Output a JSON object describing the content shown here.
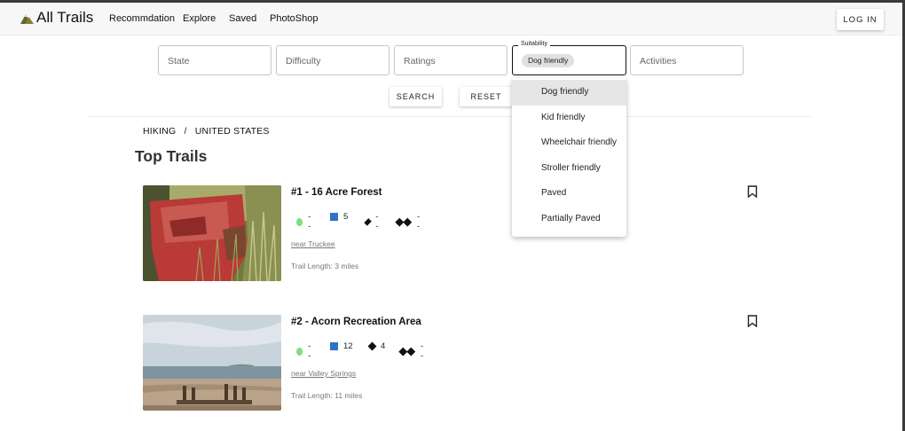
{
  "navbar": {
    "brand": "All Trails",
    "links": [
      "Recommdation",
      "Explore",
      "Saved",
      "PhotoShop"
    ],
    "login": "LOG IN"
  },
  "filters": {
    "state": "State",
    "difficulty": "Difficulty",
    "ratings": "Ratings",
    "suitability_label": "Suitability",
    "suitability_chip": "Dog friendly",
    "activities": "Activities"
  },
  "actions": {
    "search": "SEARCH",
    "reset": "RESET"
  },
  "breadcrumb": {
    "first": "HIKING",
    "sep": "/",
    "second": "UNITED STATES"
  },
  "page_title": "Top Trails",
  "trails": [
    {
      "title": "#1 - 16 Acre Forest",
      "easy": "--",
      "moderate": "5",
      "hard": "--",
      "expert": "--",
      "near": "near Truckee",
      "length": "Trail Length: 3 miles"
    },
    {
      "title": "#2 - Acorn Recreation Area",
      "easy": "--",
      "moderate": "12",
      "hard": "4",
      "expert": "--",
      "near": "near Valley Springs",
      "length": "Trail Length: 11 miles"
    }
  ],
  "dropdown": {
    "options": [
      "Dog friendly",
      "Kid friendly",
      "Wheelchair friendly",
      "Stroller friendly",
      "Paved",
      "Partially Paved"
    ],
    "selected": "Dog friendly"
  },
  "colors": {
    "easy": "#7ce07c",
    "moderate": "#2f73c4",
    "hard": "#111111"
  },
  "icons": {
    "logo": "mountain-logo-icon",
    "bookmark": "bookmark-icon",
    "easy": "green-circle-icon",
    "moderate": "blue-square-icon",
    "hard": "black-diamond-icon",
    "expert": "double-black-diamond-icon"
  }
}
